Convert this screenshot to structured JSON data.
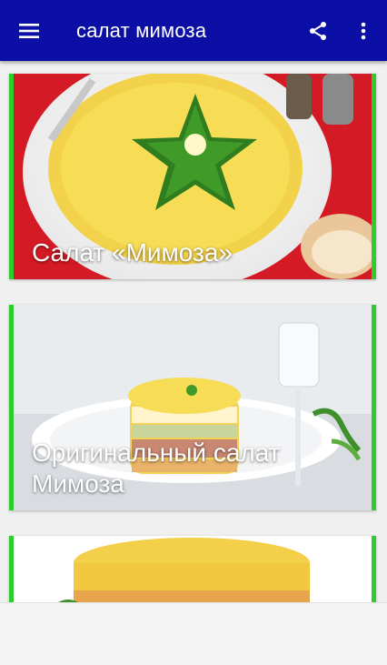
{
  "appbar": {
    "title": "салат мимоза",
    "menu_icon": "hamburger-menu-icon",
    "share_icon": "share-icon",
    "more_icon": "more-vert-icon",
    "background": "#0b0fa6"
  },
  "recipes": [
    {
      "title": "Салат «Мимоза»"
    },
    {
      "title": "Оригинальный салат Мимоза"
    },
    {
      "title": ""
    }
  ],
  "card_border_color": "#2ecc2e"
}
